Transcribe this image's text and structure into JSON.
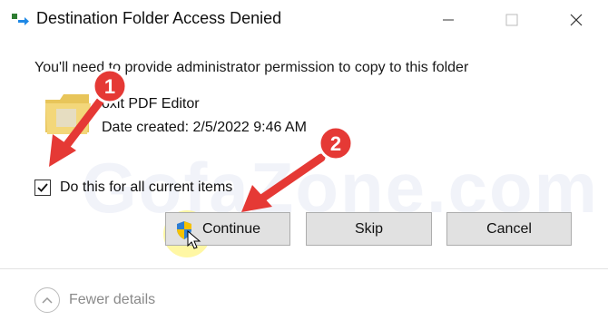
{
  "window": {
    "title": "Destination Folder Access Denied",
    "icon": "copy-files-icon",
    "controls": [
      "minimize-icon",
      "maximize-icon",
      "close-icon"
    ]
  },
  "message": {
    "heading": "You'll need to provide administrator permission to copy to this folder"
  },
  "item": {
    "icon": "folder-icon",
    "name": "oxit PDF Editor",
    "date_created": "Date created: 2/5/2022 9:46 AM"
  },
  "checkbox": {
    "label": "Do this for all current items",
    "checked": true
  },
  "buttons": {
    "continue_label": "Continue",
    "skip_label": "Skip",
    "cancel_label": "Cancel",
    "continue_icon": "uac-shield-icon"
  },
  "details": {
    "label": "Fewer details",
    "icon": "chevron-up-icon"
  },
  "watermark": "GofaZone.com",
  "annotations": {
    "badge1": "1",
    "badge2": "2",
    "color": "#e53935"
  }
}
